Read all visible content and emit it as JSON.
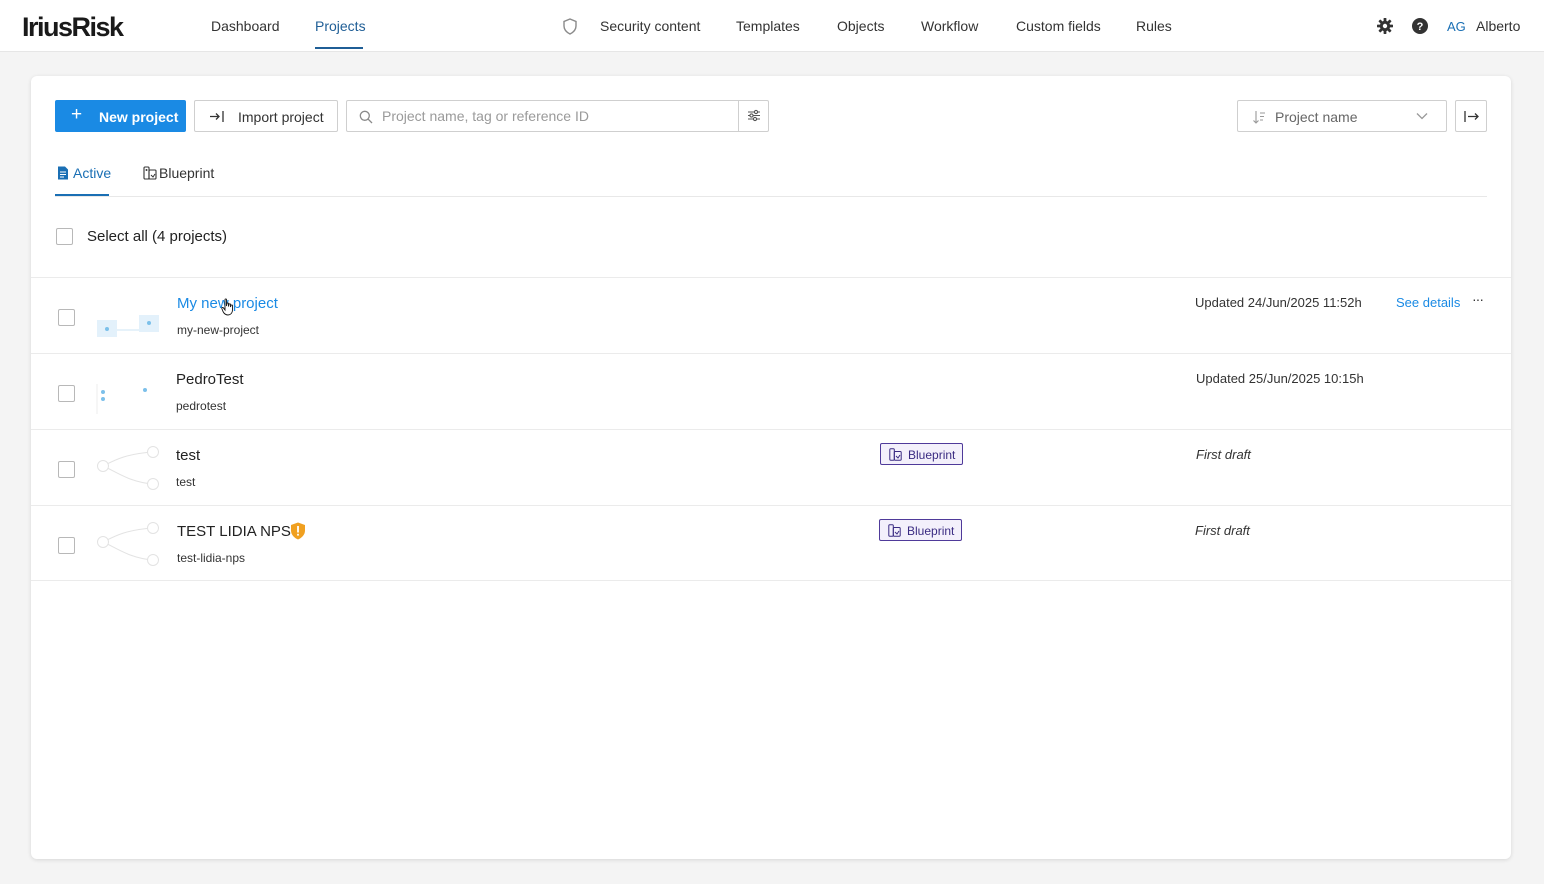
{
  "app": {
    "logo": "IriusRisk",
    "nav": {
      "dashboard": "Dashboard",
      "projects": "Projects",
      "security_content": "Security content",
      "templates": "Templates",
      "objects": "Objects",
      "workflow": "Workflow",
      "custom_fields": "Custom fields",
      "rules": "Rules"
    },
    "user": {
      "initials": "AG",
      "name": "Alberto"
    },
    "accent_color": "#1a8ae4"
  },
  "toolbar": {
    "new_project_label": "New project",
    "import_project_label": "Import project",
    "search_placeholder": "Project name, tag or reference ID",
    "sort_label": "Project name"
  },
  "tabs": [
    {
      "label": "Active",
      "active": true
    },
    {
      "label": "Blueprint",
      "active": false
    }
  ],
  "select_all_label": "Select all (4 projects)",
  "projects": [
    {
      "name": "My new project",
      "slug": "my-new-project",
      "status": "Updated 24/Jun/2025 11:52h",
      "see_details": "See details",
      "more": "···"
    },
    {
      "name": "PedroTest",
      "slug": "pedrotest",
      "status": "Updated 25/Jun/2025 10:15h"
    },
    {
      "name": "test",
      "slug": "test",
      "badge": "Blueprint",
      "status": "First draft"
    },
    {
      "name": "TEST LIDIA NPS",
      "slug": "test-lidia-nps",
      "badge": "Blueprint",
      "status": "First draft"
    }
  ]
}
